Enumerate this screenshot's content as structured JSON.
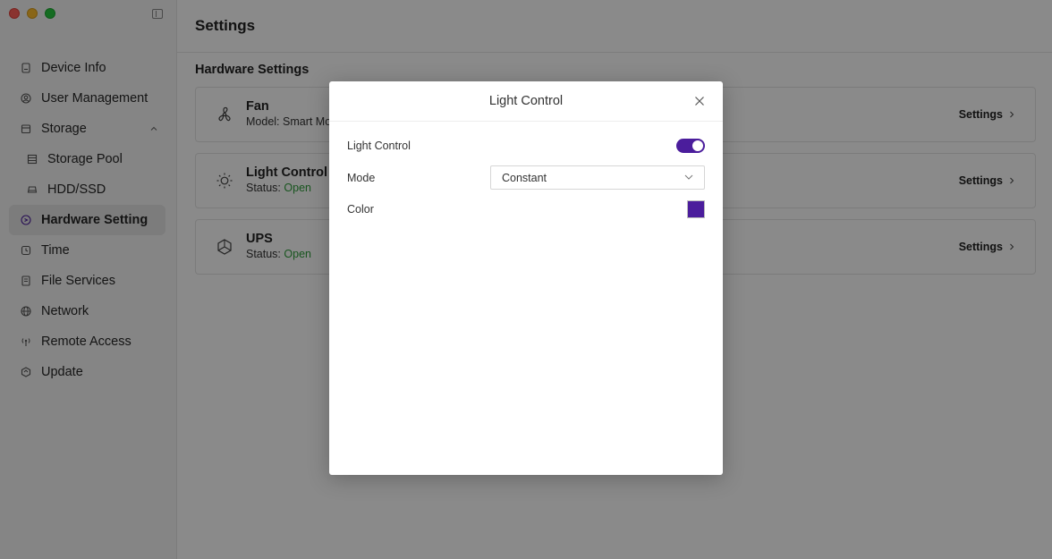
{
  "sidebar": {
    "items": [
      {
        "label": "Device Info",
        "icon": "device-icon"
      },
      {
        "label": "User Management",
        "icon": "user-icon"
      },
      {
        "label": "Storage",
        "icon": "storage-icon"
      },
      {
        "label": "Storage Pool",
        "icon": "storage-pool-icon"
      },
      {
        "label": "HDD/SSD",
        "icon": "drive-icon"
      },
      {
        "label": "Hardware Setting",
        "icon": "hardware-icon"
      },
      {
        "label": "Time",
        "icon": "clock-icon"
      },
      {
        "label": "File Services",
        "icon": "file-icon"
      },
      {
        "label": "Network",
        "icon": "globe-icon"
      },
      {
        "label": "Remote Access",
        "icon": "antenna-icon"
      },
      {
        "label": "Update",
        "icon": "update-icon"
      }
    ]
  },
  "header": {
    "title": "Settings"
  },
  "main": {
    "section_title": "Hardware Settings",
    "cards": [
      {
        "name": "Fan",
        "sub_prefix": "Model: Smart Mo",
        "status": "",
        "action": "Settings",
        "icon": "fan-icon"
      },
      {
        "name": "Light Control",
        "sub_prefix": "Status: ",
        "status": "Open",
        "action": "Settings",
        "icon": "sun-icon"
      },
      {
        "name": "UPS",
        "sub_prefix": "Status: ",
        "status": "Open",
        "action": "Settings",
        "icon": "ups-icon"
      }
    ]
  },
  "modal": {
    "title": "Light Control",
    "light_control_label": "Light Control",
    "light_control_on": true,
    "mode_label": "Mode",
    "mode_value": "Constant",
    "color_label": "Color",
    "color_value": "#4b1d9c"
  },
  "colors": {
    "accent": "#4b1d9c",
    "status_open": "#2e9e3a"
  }
}
